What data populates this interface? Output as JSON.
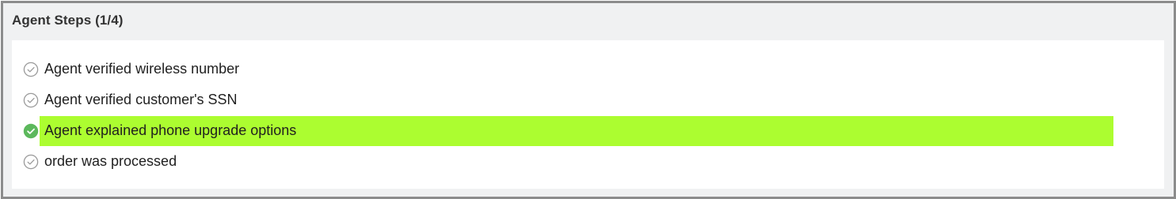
{
  "panel": {
    "title": "Agent Steps (1/4)"
  },
  "steps": [
    {
      "label": "Agent verified wireless number",
      "completed": false,
      "highlighted": false,
      "icon": "check-circle-outline-icon"
    },
    {
      "label": "Agent verified customer's SSN",
      "completed": false,
      "highlighted": false,
      "icon": "check-circle-outline-icon"
    },
    {
      "label": "Agent explained phone upgrade options",
      "completed": true,
      "highlighted": true,
      "icon": "check-circle-filled-icon"
    },
    {
      "label": "order was processed",
      "completed": false,
      "highlighted": false,
      "icon": "check-circle-outline-icon"
    }
  ],
  "colors": {
    "highlight": "#acfd30",
    "completed_icon": "#5cb85c",
    "pending_icon": "#9a9a9a",
    "header_bg": "#f0f1f2",
    "border": "#8c8c8c"
  }
}
